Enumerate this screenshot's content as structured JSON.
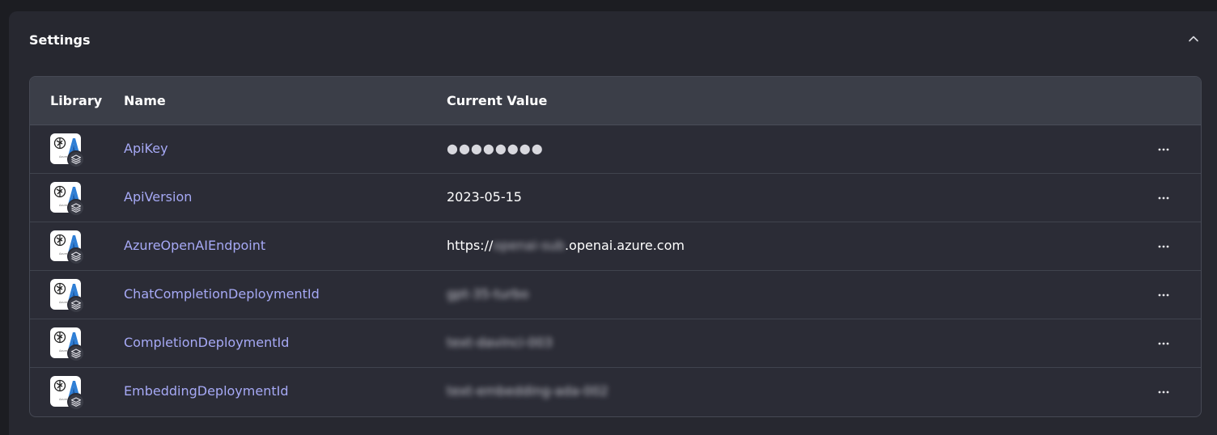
{
  "panel": {
    "title": "Settings",
    "collapse_icon": "chevron-up-icon"
  },
  "table": {
    "columns": [
      "Library",
      "Name",
      "Current Value"
    ],
    "rows": [
      {
        "library_icon": "azure-openai-icon",
        "name": "ApiKey",
        "value": "●●●●●●●●",
        "blurred": false,
        "masked": true
      },
      {
        "library_icon": "azure-openai-icon",
        "name": "ApiVersion",
        "value": "2023-05-15",
        "blurred": false
      },
      {
        "library_icon": "azure-openai-icon",
        "name": "AzureOpenAIEndpoint",
        "value_prefix": "https://",
        "value_hidden": "openai-sub",
        "value_suffix": ".openai.azure.com",
        "partially_blurred": true
      },
      {
        "library_icon": "azure-openai-icon",
        "name": "ChatCompletionDeploymentId",
        "value": "gpt-35-turbo",
        "blurred": true
      },
      {
        "library_icon": "azure-openai-icon",
        "name": "CompletionDeploymentId",
        "value": "text-davinci-003",
        "blurred": true
      },
      {
        "library_icon": "azure-openai-icon",
        "name": "EmbeddingDeploymentId",
        "value": "text-embedding-ada-002",
        "blurred": true
      }
    ],
    "row_action_icon": "more-horizontal-icon"
  },
  "colors": {
    "background": "#1c1d22",
    "panel": "#272830",
    "table_header": "#3b3e48",
    "link": "#a6a9f5"
  }
}
